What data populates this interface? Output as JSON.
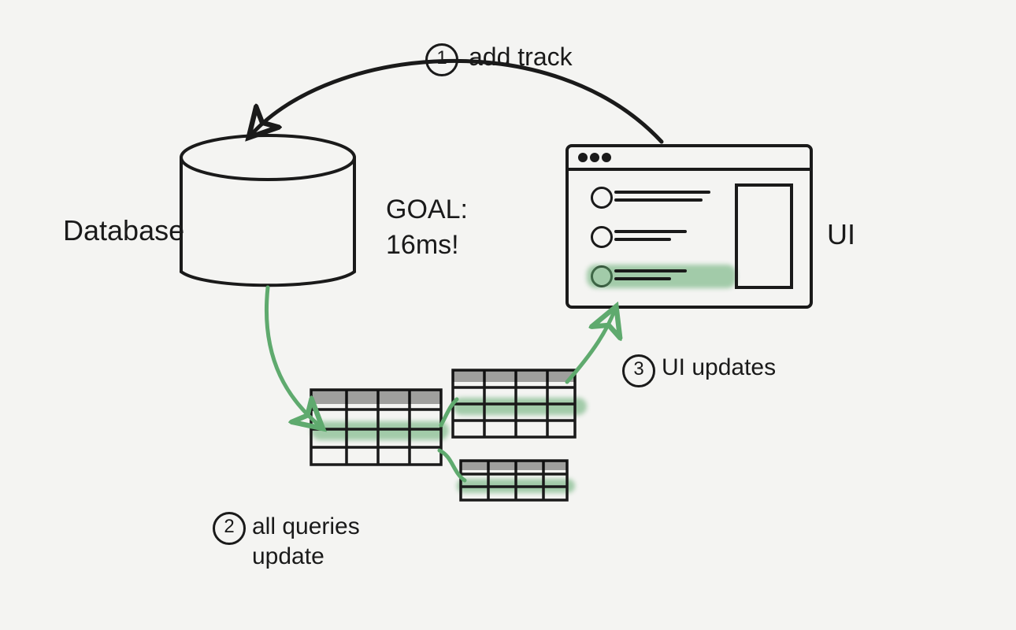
{
  "labels": {
    "database": "Database",
    "ui": "UI",
    "goal_line1": "GOAL:",
    "goal_line2": "16ms!"
  },
  "steps": {
    "s1": {
      "num": "1",
      "text": "add track"
    },
    "s2": {
      "num": "2",
      "text": "all queries\nupdate"
    },
    "s3": {
      "num": "3",
      "text": "UI updates"
    }
  },
  "colors": {
    "ink": "#1a1a1a",
    "green": "#5faa6e",
    "green_soft": "rgba(95,170,110,0.55)",
    "bg": "#f4f4f2"
  }
}
